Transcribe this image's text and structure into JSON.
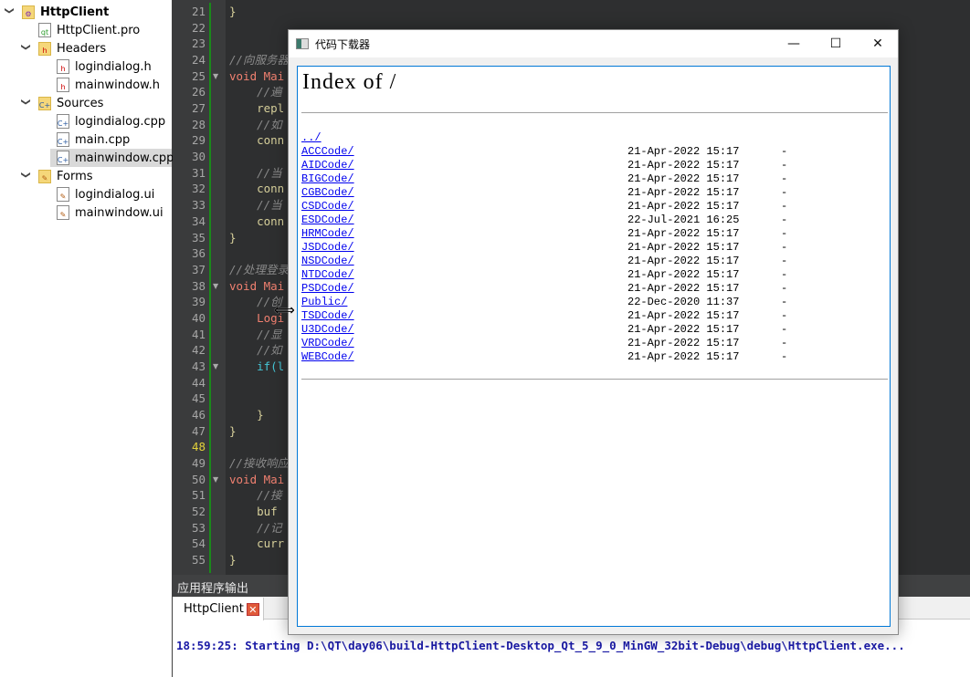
{
  "project_tree": [
    {
      "label": "HttpClient",
      "level": 0,
      "type": "project",
      "expanded": true,
      "bold": true
    },
    {
      "label": "HttpClient.pro",
      "level": 1,
      "type": "pro"
    },
    {
      "label": "Headers",
      "level": 1,
      "type": "folder-h",
      "expanded": true
    },
    {
      "label": "logindialog.h",
      "level": 2,
      "type": "h"
    },
    {
      "label": "mainwindow.h",
      "level": 2,
      "type": "h"
    },
    {
      "label": "Sources",
      "level": 1,
      "type": "folder-cpp",
      "expanded": true
    },
    {
      "label": "logindialog.cpp",
      "level": 2,
      "type": "cpp"
    },
    {
      "label": "main.cpp",
      "level": 2,
      "type": "cpp"
    },
    {
      "label": "mainwindow.cpp",
      "level": 2,
      "type": "cpp",
      "selected": true
    },
    {
      "label": "Forms",
      "level": 1,
      "type": "folder-ui",
      "expanded": true
    },
    {
      "label": "logindialog.ui",
      "level": 2,
      "type": "ui"
    },
    {
      "label": "mainwindow.ui",
      "level": 2,
      "type": "ui"
    }
  ],
  "editor": {
    "current_line": 48,
    "lines": [
      {
        "n": 21,
        "t": "}",
        "c": "tx"
      },
      {
        "n": 22,
        "t": "",
        "c": "tx"
      },
      {
        "n": 23,
        "t": "",
        "c": "tx"
      },
      {
        "n": 24,
        "t": "//向服务器",
        "c": "cm"
      },
      {
        "n": 25,
        "t": "void Mai",
        "c": "fn",
        "fold": true
      },
      {
        "n": 26,
        "t": "    //遍",
        "c": "cm"
      },
      {
        "n": 27,
        "t": "    repl",
        "c": "tx"
      },
      {
        "n": 28,
        "t": "    //如",
        "c": "cm"
      },
      {
        "n": 29,
        "t": "    conn",
        "c": "tx"
      },
      {
        "n": 30,
        "t": "",
        "c": "tx"
      },
      {
        "n": 31,
        "t": "    //当",
        "c": "cm"
      },
      {
        "n": 32,
        "t": "    conn",
        "c": "tx"
      },
      {
        "n": 33,
        "t": "    //当",
        "c": "cm"
      },
      {
        "n": 34,
        "t": "    conn",
        "c": "tx"
      },
      {
        "n": 35,
        "t": "}",
        "c": "tx"
      },
      {
        "n": 36,
        "t": "",
        "c": "tx"
      },
      {
        "n": 37,
        "t": "//处理登录",
        "c": "cm"
      },
      {
        "n": 38,
        "t": "void Mai",
        "c": "fn",
        "fold": true
      },
      {
        "n": 39,
        "t": "    //创",
        "c": "cm"
      },
      {
        "n": 40,
        "t": "    Logi",
        "c": "fn"
      },
      {
        "n": 41,
        "t": "    //显",
        "c": "cm"
      },
      {
        "n": 42,
        "t": "    //如",
        "c": "cm"
      },
      {
        "n": 43,
        "t": "    if(l",
        "c": "kw2",
        "fold": true
      },
      {
        "n": 44,
        "t": "",
        "c": "tx"
      },
      {
        "n": 45,
        "t": "",
        "c": "tx"
      },
      {
        "n": 46,
        "t": "    }",
        "c": "tx"
      },
      {
        "n": 47,
        "t": "}",
        "c": "tx"
      },
      {
        "n": 48,
        "t": "",
        "c": "tx"
      },
      {
        "n": 49,
        "t": "//接收响应",
        "c": "cm"
      },
      {
        "n": 50,
        "t": "void Mai",
        "c": "fn",
        "fold": true
      },
      {
        "n": 51,
        "t": "    //接",
        "c": "cm"
      },
      {
        "n": 52,
        "t": "    buf ",
        "c": "tx"
      },
      {
        "n": 53,
        "t": "    //记",
        "c": "cm"
      },
      {
        "n": 54,
        "t": "    curr",
        "c": "tx"
      },
      {
        "n": 55,
        "t": "}",
        "c": "tx"
      }
    ]
  },
  "output": {
    "header": "应用程序输出",
    "tab_label": "HttpClient",
    "text": "18:59:25: Starting D:\\QT\\day06\\build-HttpClient-Desktop_Qt_5_9_0_MinGW_32bit-Debug\\debug\\HttpClient.exe..."
  },
  "dialog": {
    "title": "代码下载器",
    "minimize": "—",
    "maximize": "☐",
    "close": "✕",
    "heading": "Index of /",
    "parent_link": "../",
    "entries": [
      {
        "name": "ACCCode/",
        "date": "21-Apr-2022 15:17",
        "size": "-"
      },
      {
        "name": "AIDCode/",
        "date": "21-Apr-2022 15:17",
        "size": "-"
      },
      {
        "name": "BIGCode/",
        "date": "21-Apr-2022 15:17",
        "size": "-"
      },
      {
        "name": "CGBCode/",
        "date": "21-Apr-2022 15:17",
        "size": "-"
      },
      {
        "name": "CSDCode/",
        "date": "21-Apr-2022 15:17",
        "size": "-"
      },
      {
        "name": "ESDCode/",
        "date": "22-Jul-2021 16:25",
        "size": "-"
      },
      {
        "name": "HRMCode/",
        "date": "21-Apr-2022 15:17",
        "size": "-"
      },
      {
        "name": "JSDCode/",
        "date": "21-Apr-2022 15:17",
        "size": "-"
      },
      {
        "name": "NSDCode/",
        "date": "21-Apr-2022 15:17",
        "size": "-"
      },
      {
        "name": "NTDCode/",
        "date": "21-Apr-2022 15:17",
        "size": "-"
      },
      {
        "name": "PSDCode/",
        "date": "21-Apr-2022 15:17",
        "size": "-"
      },
      {
        "name": "Public/",
        "date": "22-Dec-2020 11:37",
        "size": "-"
      },
      {
        "name": "TSDCode/",
        "date": "21-Apr-2022 15:17",
        "size": "-"
      },
      {
        "name": "U3DCode/",
        "date": "21-Apr-2022 15:17",
        "size": "-"
      },
      {
        "name": "VRDCode/",
        "date": "21-Apr-2022 15:17",
        "size": "-"
      },
      {
        "name": "WEBCode/",
        "date": "21-Apr-2022 15:17",
        "size": "-"
      }
    ]
  },
  "colors": {
    "link": "#0000ee",
    "accent_border": "#0078d7",
    "output_text": "#1a1aa6",
    "current_line_number": "#e3d23a"
  }
}
